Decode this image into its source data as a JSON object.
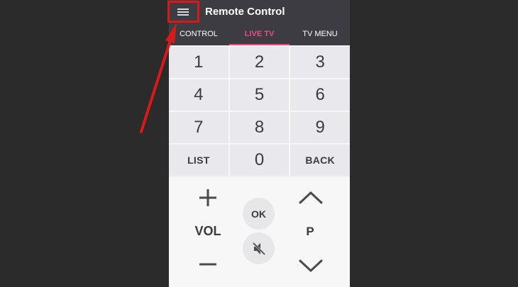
{
  "header": {
    "title": "Remote Control"
  },
  "tabs": [
    {
      "label": "CONTROL",
      "active": false
    },
    {
      "label": "LIVE TV",
      "active": true
    },
    {
      "label": "TV MENU",
      "active": false
    }
  ],
  "keypad": {
    "keys": [
      "1",
      "2",
      "3",
      "4",
      "5",
      "6",
      "7",
      "8",
      "9",
      "LIST",
      "0",
      "BACK"
    ]
  },
  "controls": {
    "volume_label": "VOL",
    "ok_label": "OK",
    "channel_label": "P"
  },
  "icons": {
    "menu": "hamburger-menu-icon",
    "volume_up": "plus-icon",
    "volume_down": "minus-icon",
    "mute": "mute-speaker-icon",
    "channel_up": "chevron-up-icon",
    "channel_down": "chevron-down-icon"
  },
  "colors": {
    "page_background": "#2b2b2b",
    "header_background": "#3d3c42",
    "active_tab": "#e84f7d",
    "key_background": "#e9e8ed",
    "annotation": "#d61a1a"
  }
}
